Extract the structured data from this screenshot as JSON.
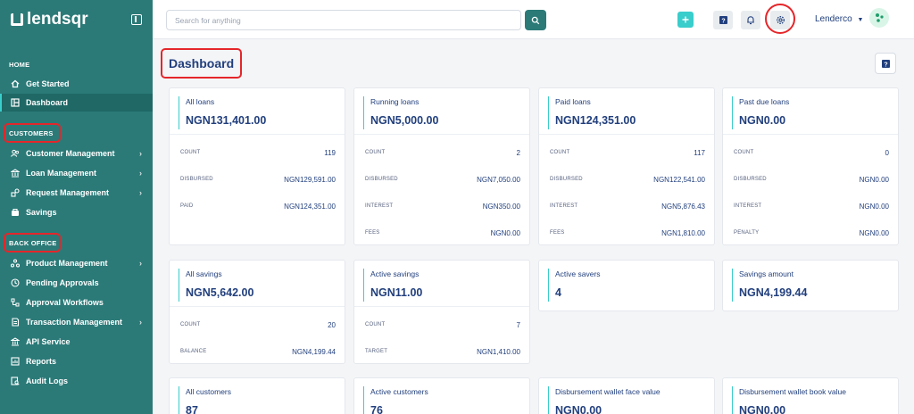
{
  "brand": {
    "name": "lendsqr"
  },
  "sidebar": {
    "sections": {
      "home": "HOME",
      "customers": "CUSTOMERS",
      "back_office": "BACK OFFICE"
    },
    "items": [
      {
        "label": "Get Started",
        "icon": "home-icon"
      },
      {
        "label": "Dashboard",
        "icon": "dashboard-icon"
      },
      {
        "label": "Customer Management",
        "icon": "users-icon"
      },
      {
        "label": "Loan Management",
        "icon": "bank-icon"
      },
      {
        "label": "Request Management",
        "icon": "request-icon"
      },
      {
        "label": "Savings",
        "icon": "piggy-bank-icon"
      },
      {
        "label": "Product Management",
        "icon": "product-icon"
      },
      {
        "label": "Pending Approvals",
        "icon": "clock-icon"
      },
      {
        "label": "Approval Workflows",
        "icon": "workflow-icon"
      },
      {
        "label": "Transaction Management",
        "icon": "transaction-icon"
      },
      {
        "label": "API Service",
        "icon": "api-icon"
      },
      {
        "label": "Reports",
        "icon": "report-icon"
      },
      {
        "label": "Audit Logs",
        "icon": "audit-icon"
      }
    ]
  },
  "topbar": {
    "search_placeholder": "Search for anything",
    "user_name": "Lenderco"
  },
  "page": {
    "title": "Dashboard"
  },
  "cards": [
    {
      "label": "All loans",
      "value": "NGN131,401.00",
      "rows": [
        {
          "k": "COUNT",
          "v": "119"
        },
        {
          "k": "DISBURSED",
          "v": "NGN129,591.00"
        },
        {
          "k": "PAID",
          "v": "NGN124,351.00"
        }
      ]
    },
    {
      "label": "Running loans",
      "value": "NGN5,000.00",
      "rows": [
        {
          "k": "COUNT",
          "v": "2"
        },
        {
          "k": "DISBURSED",
          "v": "NGN7,050.00"
        },
        {
          "k": "INTEREST",
          "v": "NGN350.00"
        },
        {
          "k": "FEES",
          "v": "NGN0.00"
        }
      ]
    },
    {
      "label": "Paid loans",
      "value": "NGN124,351.00",
      "rows": [
        {
          "k": "COUNT",
          "v": "117"
        },
        {
          "k": "DISBURSED",
          "v": "NGN122,541.00"
        },
        {
          "k": "INTEREST",
          "v": "NGN5,876.43"
        },
        {
          "k": "FEES",
          "v": "NGN1,810.00"
        }
      ]
    },
    {
      "label": "Past due loans",
      "value": "NGN0.00",
      "rows": [
        {
          "k": "COUNT",
          "v": "0"
        },
        {
          "k": "DISBURSED",
          "v": "NGN0.00"
        },
        {
          "k": "INTEREST",
          "v": "NGN0.00"
        },
        {
          "k": "PENALTY",
          "v": "NGN0.00"
        }
      ]
    },
    {
      "label": "All savings",
      "value": "NGN5,642.00",
      "rows": [
        {
          "k": "COUNT",
          "v": "20"
        },
        {
          "k": "BALANCE",
          "v": "NGN4,199.44"
        }
      ]
    },
    {
      "label": "Active savings",
      "value": "NGN11.00",
      "rows": [
        {
          "k": "COUNT",
          "v": "7"
        },
        {
          "k": "TARGET",
          "v": "NGN1,410.00"
        }
      ]
    },
    {
      "label": "Active savers",
      "value": "4",
      "rows": []
    },
    {
      "label": "Savings amount",
      "value": "NGN4,199.44",
      "rows": []
    },
    {
      "label": "All customers",
      "value": "87",
      "rows": []
    },
    {
      "label": "Active customers",
      "value": "76",
      "rows": []
    },
    {
      "label": "Disbursement wallet face value",
      "value": "NGN0.00",
      "rows": []
    },
    {
      "label": "Disbursement wallet book value",
      "value": "NGN0.00",
      "rows": []
    }
  ],
  "colors": {
    "sidebar": "#2b7a78",
    "accent": "#39cdcc",
    "text": "#213f7d",
    "highlight": "#e5262a"
  }
}
